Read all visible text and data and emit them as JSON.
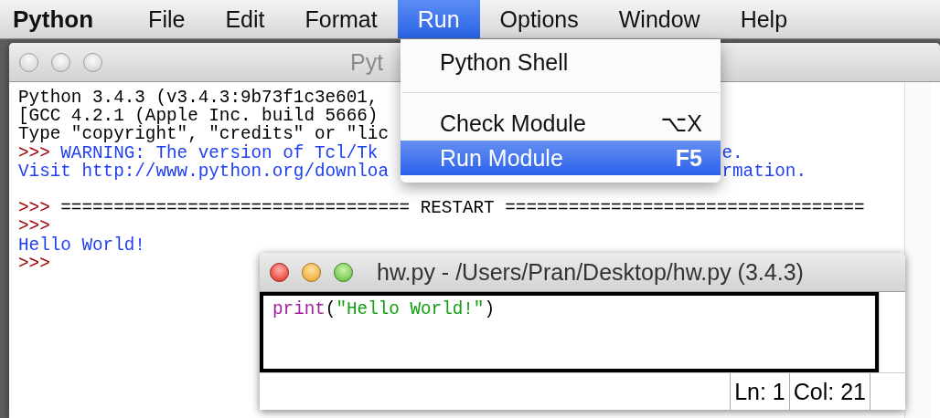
{
  "menubar": {
    "items": [
      {
        "label": "Python",
        "kind": "app",
        "selected": false
      },
      {
        "label": "File",
        "kind": "menu",
        "selected": false
      },
      {
        "label": "Edit",
        "kind": "menu",
        "selected": false
      },
      {
        "label": "Format",
        "kind": "menu",
        "selected": false
      },
      {
        "label": "Run",
        "kind": "menu",
        "selected": true
      },
      {
        "label": "Options",
        "kind": "menu",
        "selected": false
      },
      {
        "label": "Window",
        "kind": "menu",
        "selected": false
      },
      {
        "label": "Help",
        "kind": "menu",
        "selected": false
      }
    ]
  },
  "shell_window": {
    "title": "Pyt",
    "active": false,
    "lines": [
      {
        "kind": "text",
        "segments": [
          {
            "kind": "output",
            "text": "Python 3.4.3 (v3.4.3:9b73f1c3e601,"
          }
        ]
      },
      {
        "kind": "text",
        "segments": [
          {
            "kind": "output",
            "text": "[GCC 4.2.1 (Apple Inc. build 5666)"
          }
        ]
      },
      {
        "kind": "text",
        "segments": [
          {
            "kind": "output",
            "text": "Type \"copyright\", \"credits\" or \"lic"
          }
        ]
      },
      {
        "kind": "text",
        "segments": [
          {
            "kind": "prompt",
            "text": ">>>"
          },
          {
            "kind": "stdout",
            "text": "WARNING: The version of Tcl/Tk"
          }
        ],
        "tail": [
          {
            "kind": "stdout",
            "text": "e."
          }
        ]
      },
      {
        "kind": "text",
        "segments": [
          {
            "kind": "stdout",
            "text": "Visit http://www.python.org/downloa"
          }
        ],
        "tail": [
          {
            "kind": "stdout",
            "text": "rmation."
          }
        ]
      },
      {
        "kind": "blank"
      },
      {
        "kind": "text",
        "segments": [
          {
            "kind": "prompt",
            "text": ">>>"
          },
          {
            "kind": "output",
            "text": "================================= RESTART =================================="
          }
        ]
      },
      {
        "kind": "text",
        "segments": [
          {
            "kind": "prompt",
            "text": ">>>"
          }
        ]
      },
      {
        "kind": "text",
        "segments": [
          {
            "kind": "stdout",
            "text": "Hello World!"
          }
        ]
      },
      {
        "kind": "text",
        "segments": [
          {
            "kind": "prompt",
            "text": ">>>"
          }
        ]
      }
    ]
  },
  "editor_window": {
    "title": "hw.py - /Users/Pran/Desktop/hw.py (3.4.3)",
    "active": true,
    "code": [
      {
        "kind": "keyword",
        "text": "print"
      },
      {
        "kind": "plain",
        "text": "("
      },
      {
        "kind": "string",
        "text": "\"Hello World!\""
      },
      {
        "kind": "plain",
        "text": ")"
      }
    ],
    "status": {
      "line": "Ln: 1",
      "column": "Col: 21"
    }
  },
  "run_menu": {
    "items": [
      {
        "kind": "item",
        "label": "Python Shell",
        "selected": false
      },
      {
        "kind": "separator"
      },
      {
        "kind": "item",
        "label": "Check Module",
        "shortcut": "⌥X",
        "selected": false
      },
      {
        "kind": "item",
        "label": "Run Module",
        "shortcut": "F5",
        "selected": true
      }
    ]
  }
}
